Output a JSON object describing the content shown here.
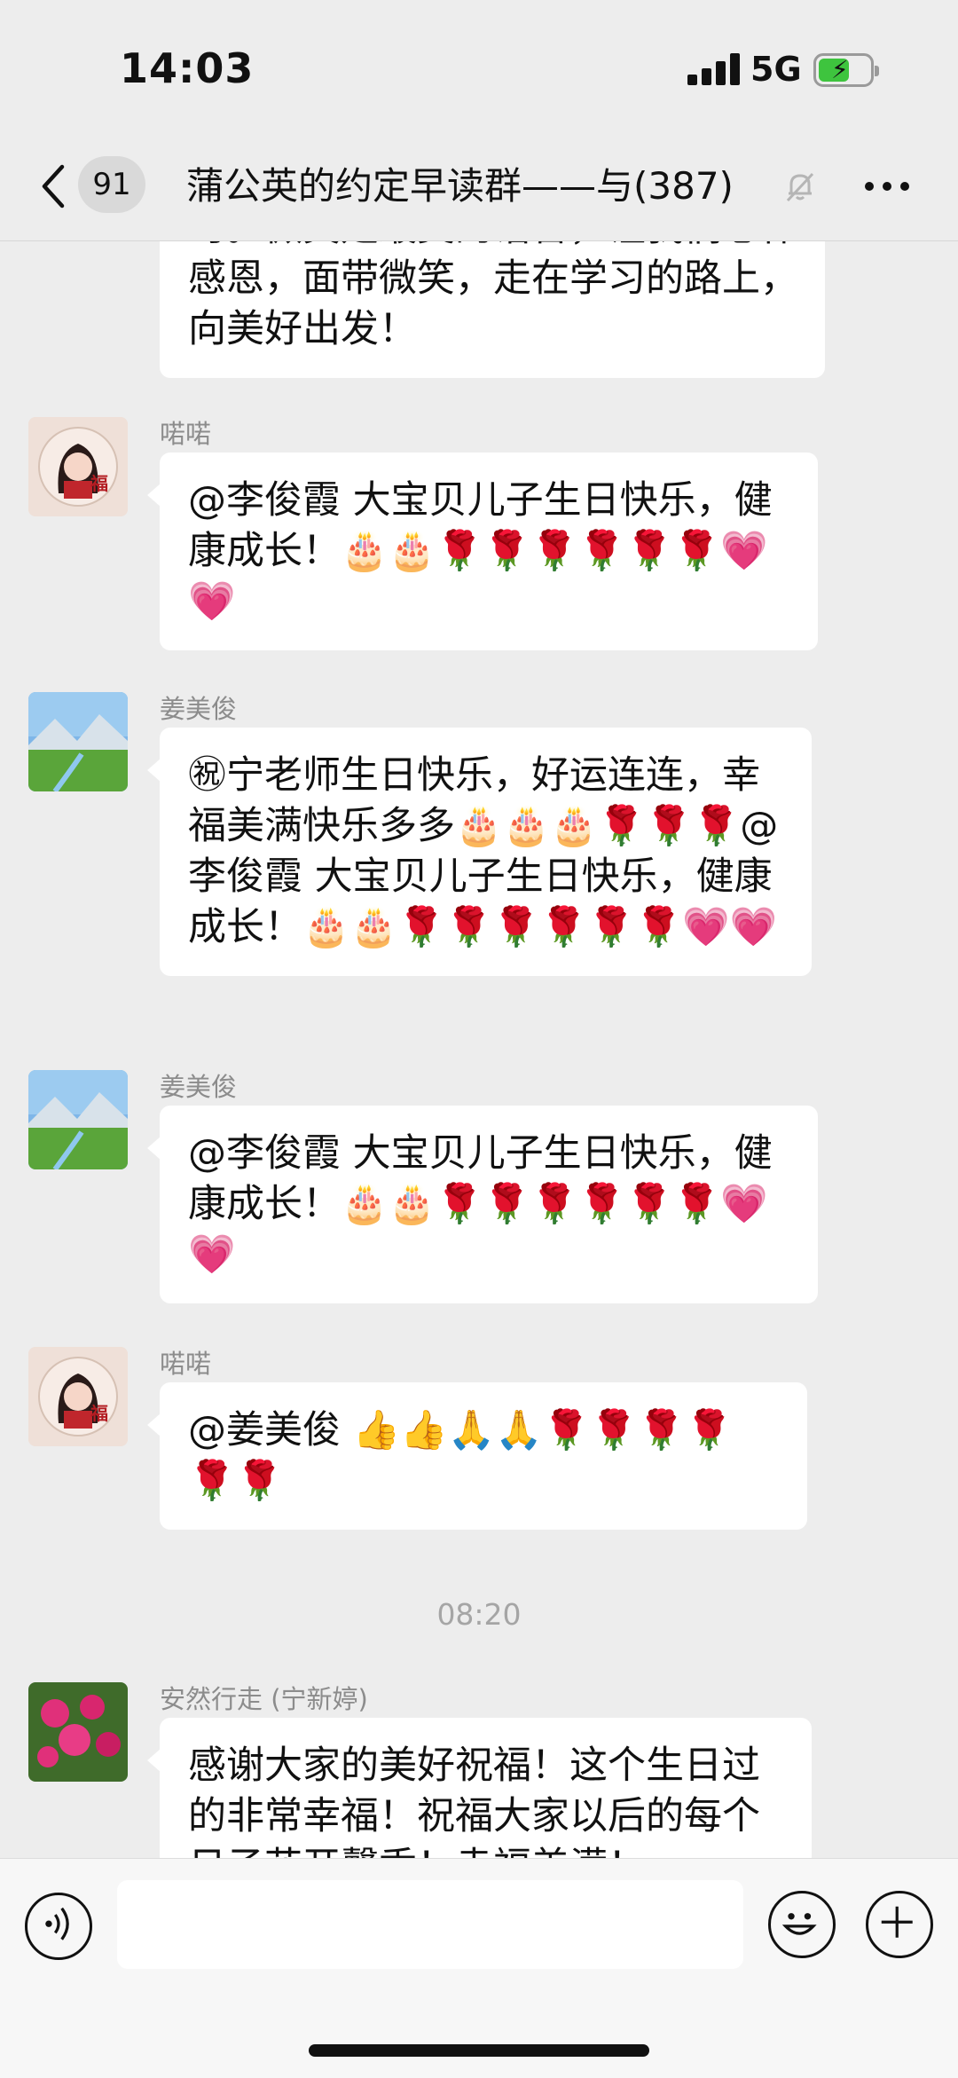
{
  "status": {
    "time": "14:03",
    "network": "5G",
    "battery_level": 0.6
  },
  "nav": {
    "unread_count": "91",
    "title": "蒲公英的约定早读群——与(387)"
  },
  "messages": [
    {
      "partial_text": "时。微笑是最美的语言，让我们心怀感恩，面带微笑，走在学习的路上，向美好出发！"
    },
    {
      "sender": "喏喏",
      "text": "@李俊霞 大宝贝儿子生日快乐，健康成长！🎂🎂🌹🌹🌹🌹🌹🌹💗💗"
    },
    {
      "sender": "姜美俊",
      "text": "㊗宁老师生日快乐，好运连连，幸福美满快乐多多🎂🎂🎂🌹🌹🌹@李俊霞 大宝贝儿子生日快乐，健康成长！🎂🎂🌹🌹🌹🌹🌹🌹💗💗"
    },
    {
      "sender": "姜美俊",
      "text": "@李俊霞 大宝贝儿子生日快乐，健康成长！🎂🎂🌹🌹🌹🌹🌹🌹💗💗"
    },
    {
      "sender": "喏喏",
      "text": "@姜美俊 👍👍🙏🙏🌹🌹🌹🌹🌹🌹"
    },
    {
      "sender": "安然行走 (宁新婷)",
      "text": "感谢大家的美好祝福！这个生日过的非常幸福！祝福大家以后的每个日子花开馨香！幸福美满！"
    }
  ],
  "time_divider": "08:20",
  "colors": {
    "background": "#ededed",
    "bubble": "#ffffff",
    "sender_name": "#8c8c8c",
    "battery": "#3ec43e"
  },
  "icons": [
    "back-chevron-icon",
    "mute-bell-icon",
    "more-dots-icon",
    "voice-icon",
    "emoji-icon",
    "plus-icon"
  ]
}
